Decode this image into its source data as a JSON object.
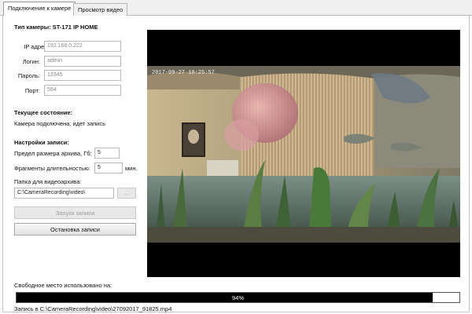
{
  "tabs": [
    {
      "label": "Подключение к камере"
    },
    {
      "label": "Просмотр видео"
    }
  ],
  "camera": {
    "type_label": "Тип камеры: ST-171 IP HOME",
    "ip_label": "IP адрес:",
    "ip_value": "192.168.0.222",
    "login_label": "Логин:",
    "login_value": "admin",
    "password_label": "Пароль:",
    "password_value": "12345",
    "port_label": "Порт:",
    "port_value": "554"
  },
  "status": {
    "heading": "Текущее состояние:",
    "text": "Камера подключена, идет запись"
  },
  "settings": {
    "heading": "Настройки записи:",
    "archive_limit_label": "Предел размера архива, Гб:",
    "archive_limit_value": "5",
    "fragment_label": "Фрагменты длительностью:",
    "fragment_value": "5",
    "fragment_unit": "мин.",
    "folder_label": "Папка для видеоархива:",
    "folder_value": "C:\\CameraRecording\\video\\",
    "browse_label": "..."
  },
  "buttons": {
    "start": "Запуск записи",
    "stop": "Остановка записи"
  },
  "video": {
    "timestamp": "2017-09-27 10:25:57"
  },
  "disk": {
    "label": "Свободное место использовано на:",
    "percent": 94,
    "percent_text": "94%"
  },
  "footer": {
    "recording_text": "Запись в C:\\CameraRecording\\video\\27092017_91825.mp4"
  },
  "colors": {
    "progress_fill": "#000000",
    "video_bg": "#000000"
  }
}
